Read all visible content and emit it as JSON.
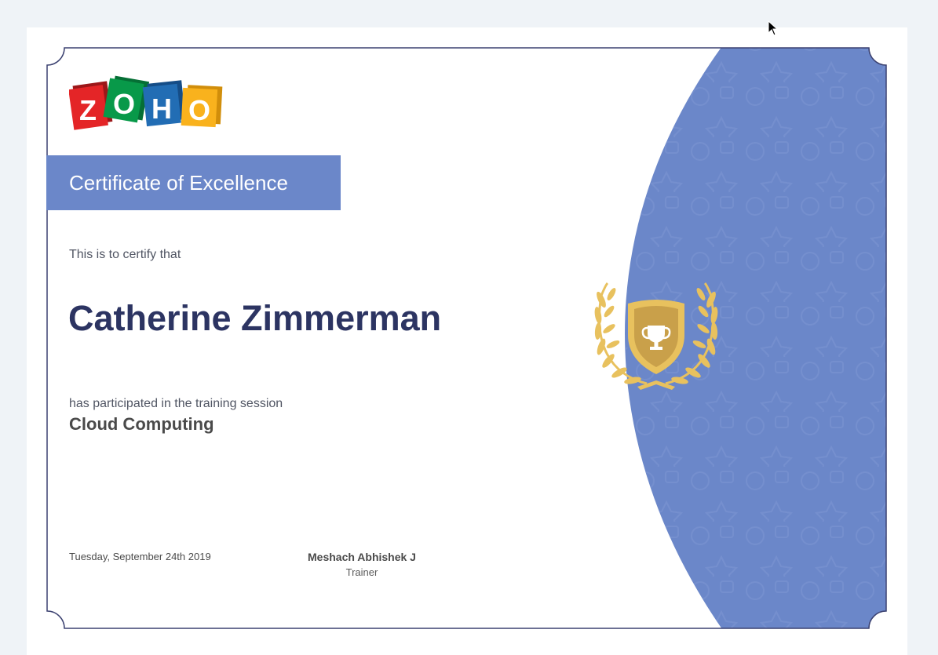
{
  "brand": {
    "logo_letters": [
      "Z",
      "O",
      "H",
      "O"
    ],
    "logo_colors": [
      "#e42527",
      "#089949",
      "#226db4",
      "#f9b21d"
    ]
  },
  "certificate": {
    "title": "Certificate of Excellence",
    "intro": "This is to certify that",
    "recipient": "Catherine Zimmerman",
    "participation_text": "has participated in the training session",
    "course": "Cloud Computing",
    "date": "Tuesday, September 24th 2019",
    "trainer_name": "Meshach Abhishek J",
    "trainer_role": "Trainer"
  },
  "colors": {
    "accent": "#6b87c9",
    "name": "#2c3462",
    "border": "#3b4170",
    "badge_gold": "#e8c15e",
    "badge_dark": "#c9a04a"
  },
  "icons": {
    "emblem": "trophy-shield-laurel-icon",
    "cursor": "mouse-pointer-icon"
  }
}
